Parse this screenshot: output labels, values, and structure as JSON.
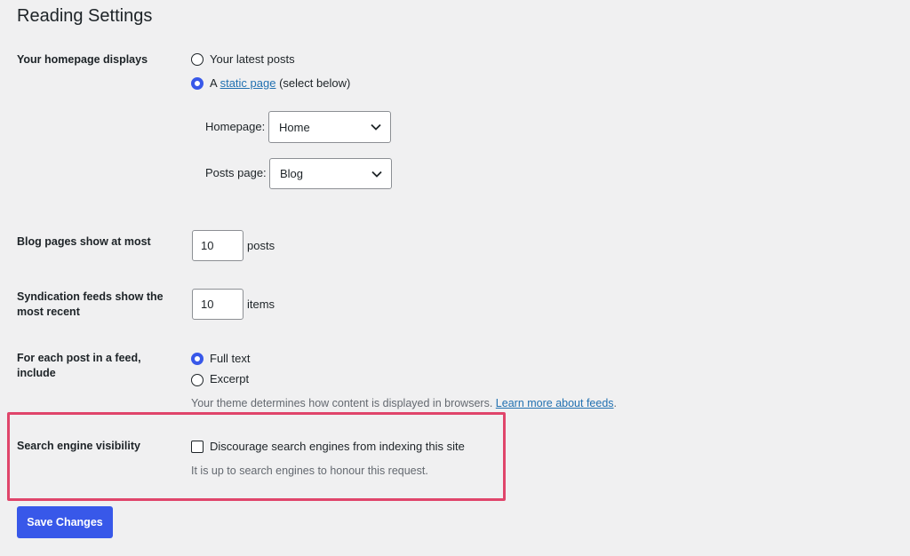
{
  "page": {
    "title": "Reading Settings"
  },
  "homepage": {
    "label": "Your homepage displays",
    "option_latest": "Your latest posts",
    "option_static_prefix": "A",
    "option_static_link": "static page",
    "option_static_suffix": "(select below)",
    "selected": "static",
    "homepage_label": "Homepage:",
    "homepage_value": "Home",
    "posts_page_label": "Posts page:",
    "posts_page_value": "Blog"
  },
  "blog_pages": {
    "label": "Blog pages show at most",
    "value": "10",
    "unit": "posts"
  },
  "syndication": {
    "label": "Syndication feeds show the most recent",
    "value": "10",
    "unit": "items"
  },
  "feed_content": {
    "label": "For each post in a feed, include",
    "option_full": "Full text",
    "option_excerpt": "Excerpt",
    "selected": "full",
    "note": "Your theme determines how content is displayed in browsers.",
    "note_link": "Learn more about feeds",
    "note_end": "."
  },
  "search_visibility": {
    "label": "Search engine visibility",
    "checkbox_label": "Discourage search engines from indexing this site",
    "checked": false,
    "description": "It is up to search engines to honour this request."
  },
  "actions": {
    "save_label": "Save Changes"
  },
  "colors": {
    "accent": "#3858e9",
    "highlight": "#e0456b",
    "background": "#f0f0f1",
    "link": "#2271b1"
  }
}
